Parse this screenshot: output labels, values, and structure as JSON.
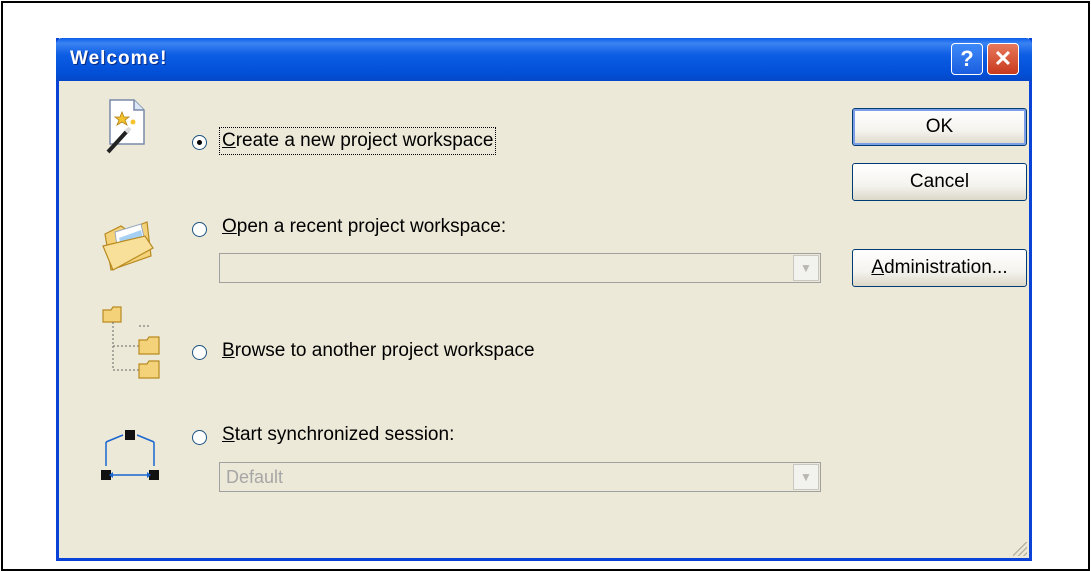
{
  "window": {
    "title": "Welcome!",
    "help_glyph": "?",
    "close_glyph": "✕"
  },
  "options": [
    {
      "label": "Create a new project workspace",
      "mnemonic": "C",
      "checked": true,
      "icon": "new-project-wand-icon"
    },
    {
      "label": "Open a recent project workspace:",
      "mnemonic": "O",
      "checked": false,
      "icon": "open-folder-icon"
    },
    {
      "label": "Browse to another project workspace",
      "mnemonic": "B",
      "checked": false,
      "icon": "folder-tree-icon"
    },
    {
      "label": "Start synchronized session:",
      "mnemonic": "S",
      "checked": false,
      "icon": "synchronized-session-icon"
    }
  ],
  "recent_combo": {
    "value": ""
  },
  "session_combo": {
    "value": "Default"
  },
  "buttons": {
    "ok": "OK",
    "cancel": "Cancel",
    "administration": "Administration..."
  },
  "colors": {
    "titlebar": "#0350d8",
    "dialog_bg": "#ece9d8",
    "close": "#c83a1e"
  }
}
